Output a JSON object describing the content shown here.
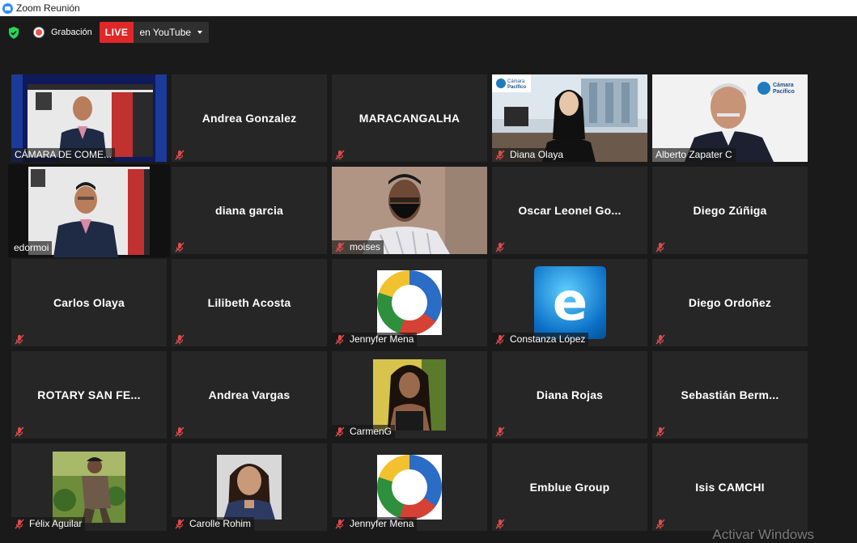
{
  "window": {
    "title": "Zoom Reunión"
  },
  "toolbar": {
    "recording_label": "Grabación",
    "live_label": "LIVE",
    "stream_target": "en YouTube"
  },
  "participants": [
    {
      "name": "CÁMARA DE COME...",
      "display": "video",
      "muted": true,
      "active": false
    },
    {
      "name": "Andrea Gonzalez",
      "display": "name",
      "muted": true
    },
    {
      "name": "MARACANGALHA",
      "display": "name",
      "muted": true
    },
    {
      "name": "Diana Olaya",
      "display": "video",
      "muted": true
    },
    {
      "name": "Alberto Zapater C",
      "display": "video",
      "muted": false
    },
    {
      "name": "edormoi",
      "display": "video",
      "muted": false,
      "active": true
    },
    {
      "name": "diana garcia",
      "display": "name",
      "muted": true
    },
    {
      "name": "moises",
      "display": "video",
      "muted": true
    },
    {
      "name": "Oscar  Leonel  Go...",
      "display": "name",
      "muted": true
    },
    {
      "name": "Diego Zúñiga",
      "display": "name",
      "muted": true
    },
    {
      "name": "Carlos Olaya",
      "display": "name",
      "muted": true
    },
    {
      "name": "Lilibeth Acosta",
      "display": "name",
      "muted": true
    },
    {
      "name": "Jennyfer Mena",
      "display": "picture",
      "muted": true
    },
    {
      "name": "Constanza López",
      "display": "picture",
      "muted": true
    },
    {
      "name": "Diego Ordoñez",
      "display": "name",
      "muted": true
    },
    {
      "name": "ROTARY SAN FE...",
      "display": "name",
      "muted": true
    },
    {
      "name": "Andrea Vargas",
      "display": "name",
      "muted": true
    },
    {
      "name": "CarmenG",
      "display": "picture",
      "muted": true
    },
    {
      "name": "Diana Rojas",
      "display": "name",
      "muted": true
    },
    {
      "name": "Sebastián  Berm...",
      "display": "name",
      "muted": true
    },
    {
      "name": "Félix Aguilar",
      "display": "picture",
      "muted": true
    },
    {
      "name": "Carolle Rohim",
      "display": "picture",
      "muted": true
    },
    {
      "name": "Jennyfer Mena",
      "display": "picture",
      "muted": true
    },
    {
      "name": "Emblue Group",
      "display": "name",
      "muted": true
    },
    {
      "name": "Isis CAMCHI",
      "display": "name",
      "muted": true
    }
  ],
  "video_text": {
    "camara_logo_line1": "Cámara",
    "camara_logo_line2": "Pacífico",
    "e_logo": "e"
  },
  "os_watermark": "Activar Windows"
}
